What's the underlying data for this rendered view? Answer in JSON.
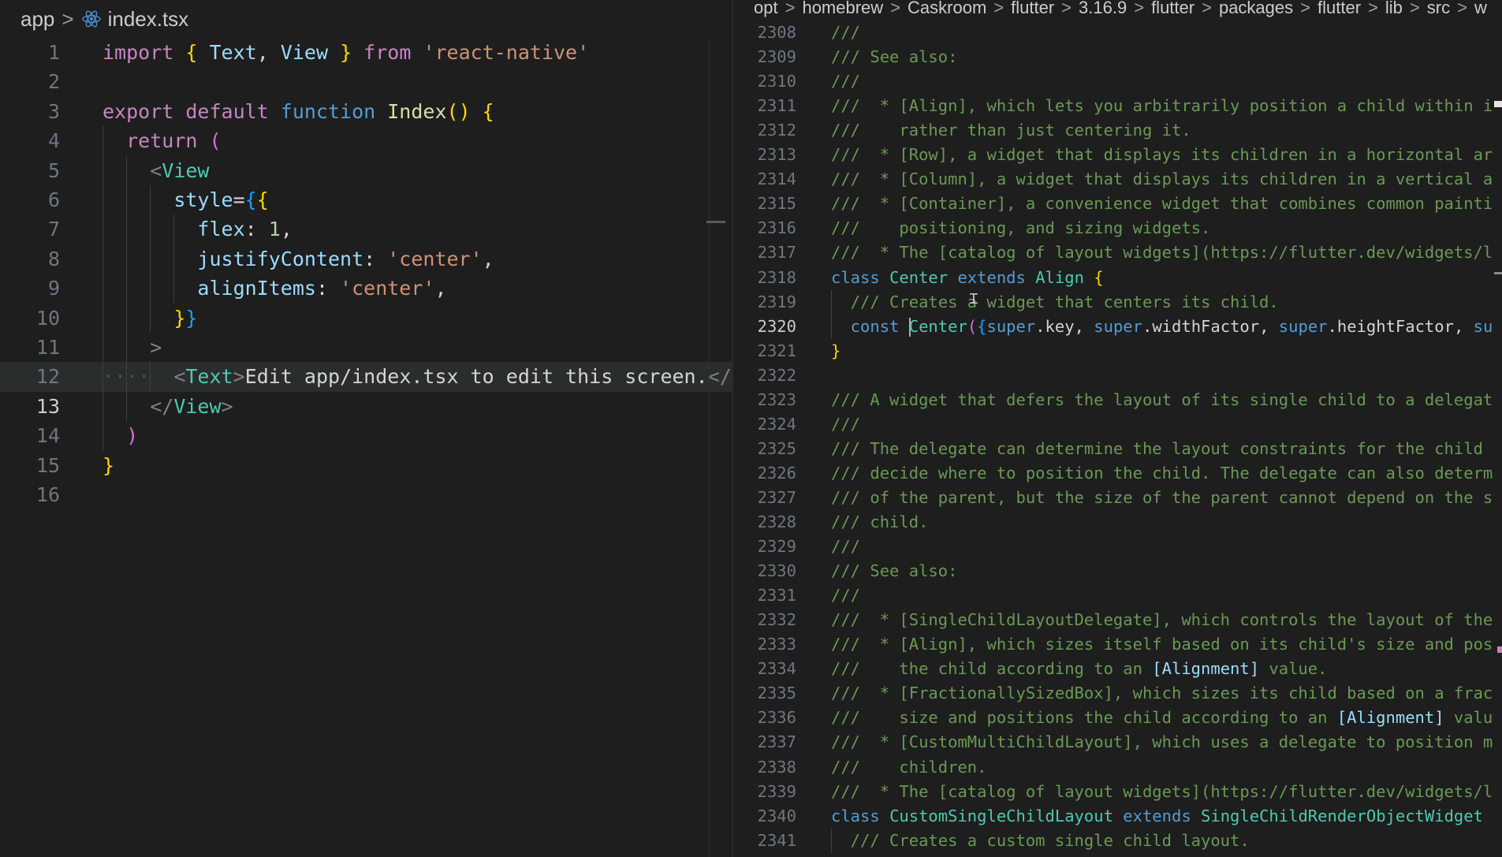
{
  "left_pane": {
    "breadcrumb": [
      "app",
      "index.tsx"
    ],
    "file_icon": "react-icon",
    "active_line": 13,
    "lines": [
      {
        "n": "1",
        "tokens": [
          {
            "t": "import ",
            "c": "kw"
          },
          {
            "t": "{ ",
            "c": "br1"
          },
          {
            "t": "Text",
            "c": "id"
          },
          {
            "t": ", ",
            "c": "tx"
          },
          {
            "t": "View",
            "c": "id"
          },
          {
            "t": " }",
            "c": "br1"
          },
          {
            "t": " from ",
            "c": "kw"
          },
          {
            "t": "'react-native'",
            "c": "str"
          }
        ]
      },
      {
        "n": "2",
        "tokens": []
      },
      {
        "n": "3",
        "tokens": [
          {
            "t": "export ",
            "c": "kw"
          },
          {
            "t": "default ",
            "c": "kw"
          },
          {
            "t": "function ",
            "c": "st"
          },
          {
            "t": "Index",
            "c": "fn"
          },
          {
            "t": "() ",
            "c": "br1"
          },
          {
            "t": "{",
            "c": "br1"
          }
        ]
      },
      {
        "n": "4",
        "tokens": [
          {
            "t": "  ",
            "c": "tx"
          },
          {
            "t": "return ",
            "c": "kw"
          },
          {
            "t": "(",
            "c": "br2"
          }
        ]
      },
      {
        "n": "5",
        "tokens": [
          {
            "t": "    ",
            "c": "tx"
          },
          {
            "t": "<",
            "c": "ang"
          },
          {
            "t": "View",
            "c": "tag"
          }
        ]
      },
      {
        "n": "6",
        "tokens": [
          {
            "t": "      ",
            "c": "tx"
          },
          {
            "t": "style",
            "c": "id"
          },
          {
            "t": "=",
            "c": "tx"
          },
          {
            "t": "{",
            "c": "br3"
          },
          {
            "t": "{",
            "c": "br1"
          }
        ]
      },
      {
        "n": "7",
        "tokens": [
          {
            "t": "        ",
            "c": "tx"
          },
          {
            "t": "flex",
            "c": "id"
          },
          {
            "t": ": ",
            "c": "tx"
          },
          {
            "t": "1",
            "c": "num"
          },
          {
            "t": ",",
            "c": "tx"
          }
        ]
      },
      {
        "n": "8",
        "tokens": [
          {
            "t": "        ",
            "c": "tx"
          },
          {
            "t": "justifyContent",
            "c": "id"
          },
          {
            "t": ": ",
            "c": "tx"
          },
          {
            "t": "'center'",
            "c": "str"
          },
          {
            "t": ",",
            "c": "tx"
          }
        ]
      },
      {
        "n": "9",
        "tokens": [
          {
            "t": "        ",
            "c": "tx"
          },
          {
            "t": "alignItems",
            "c": "id"
          },
          {
            "t": ": ",
            "c": "tx"
          },
          {
            "t": "'center'",
            "c": "str"
          },
          {
            "t": ",",
            "c": "tx"
          }
        ]
      },
      {
        "n": "10",
        "tokens": [
          {
            "t": "      ",
            "c": "tx"
          },
          {
            "t": "}",
            "c": "br1"
          },
          {
            "t": "}",
            "c": "br3"
          }
        ]
      },
      {
        "n": "11",
        "tokens": [
          {
            "t": "    ",
            "c": "tx"
          },
          {
            "t": ">",
            "c": "ang"
          }
        ]
      },
      {
        "n": "12",
        "tokens": [
          {
            "t": "····  ",
            "c": "whitespace"
          },
          {
            "t": "<",
            "c": "ang"
          },
          {
            "t": "Text",
            "c": "tag"
          },
          {
            "t": ">",
            "c": "ang"
          },
          {
            "t": "Edit app/index.tsx to edit this screen.",
            "c": "tx"
          },
          {
            "t": "</",
            "c": "ang"
          }
        ]
      },
      {
        "n": "13",
        "tokens": [
          {
            "t": "    ",
            "c": "tx"
          },
          {
            "t": "</",
            "c": "ang"
          },
          {
            "t": "View",
            "c": "tag"
          },
          {
            "t": ">",
            "c": "ang"
          }
        ]
      },
      {
        "n": "14",
        "tokens": [
          {
            "t": "  ",
            "c": "tx"
          },
          {
            "t": ")",
            "c": "br2"
          }
        ]
      },
      {
        "n": "15",
        "tokens": [
          {
            "t": "}",
            "c": "br1"
          }
        ]
      },
      {
        "n": "16",
        "tokens": []
      }
    ]
  },
  "right_pane": {
    "breadcrumb": [
      "opt",
      "homebrew",
      "Caskroom",
      "flutter",
      "3.16.9",
      "flutter",
      "packages",
      "flutter",
      "lib",
      "src",
      "w"
    ],
    "active_line": 2320,
    "lines": [
      {
        "n": "2308",
        "tokens": [
          {
            "t": "///",
            "c": "cm"
          }
        ]
      },
      {
        "n": "2309",
        "tokens": [
          {
            "t": "/// See also:",
            "c": "cm"
          }
        ]
      },
      {
        "n": "2310",
        "tokens": [
          {
            "t": "///",
            "c": "cm"
          }
        ]
      },
      {
        "n": "2311",
        "tokens": [
          {
            "t": "///  * [Align], which lets you arbitrarily position a child within i",
            "c": "cm"
          }
        ]
      },
      {
        "n": "2312",
        "tokens": [
          {
            "t": "///    rather than just centering it.",
            "c": "cm"
          }
        ]
      },
      {
        "n": "2313",
        "tokens": [
          {
            "t": "///  * [Row], a widget that displays its children in a horizontal ar",
            "c": "cm"
          }
        ]
      },
      {
        "n": "2314",
        "tokens": [
          {
            "t": "///  * [Column], a widget that displays its children in a vertical a",
            "c": "cm"
          }
        ]
      },
      {
        "n": "2315",
        "tokens": [
          {
            "t": "///  * [Container], a convenience widget that combines common painti",
            "c": "cm"
          }
        ]
      },
      {
        "n": "2316",
        "tokens": [
          {
            "t": "///    positioning, and sizing widgets.",
            "c": "cm"
          }
        ]
      },
      {
        "n": "2317",
        "tokens": [
          {
            "t": "///  * The [catalog of layout widgets](https://flutter.dev/widgets/l",
            "c": "cm"
          }
        ]
      },
      {
        "n": "2318",
        "tokens": [
          {
            "t": "class ",
            "c": "st"
          },
          {
            "t": "Center ",
            "c": "ty"
          },
          {
            "t": "extends ",
            "c": "st"
          },
          {
            "t": "Align ",
            "c": "ty"
          },
          {
            "t": "{",
            "c": "br1"
          }
        ]
      },
      {
        "n": "2319",
        "tokens": [
          {
            "t": "  /// Creates a widget that centers its child.",
            "c": "cm"
          }
        ]
      },
      {
        "n": "2320",
        "tokens": [
          {
            "t": "  const ",
            "c": "st"
          },
          {
            "t": "CURSOR",
            "c": "cursor"
          },
          {
            "t": "Center",
            "c": "ty"
          },
          {
            "t": "(",
            "c": "br2"
          },
          {
            "t": "{",
            "c": "br3"
          },
          {
            "t": "super",
            "c": "st"
          },
          {
            "t": ".key, ",
            "c": "tx"
          },
          {
            "t": "super",
            "c": "st"
          },
          {
            "t": ".widthFactor, ",
            "c": "tx"
          },
          {
            "t": "super",
            "c": "st"
          },
          {
            "t": ".heightFactor, ",
            "c": "tx"
          },
          {
            "t": "su",
            "c": "st"
          }
        ]
      },
      {
        "n": "2321",
        "tokens": [
          {
            "t": "}",
            "c": "br1"
          }
        ]
      },
      {
        "n": "2322",
        "tokens": []
      },
      {
        "n": "2323",
        "tokens": [
          {
            "t": "/// A widget that defers the layout of its single child to a delegat",
            "c": "cm"
          }
        ]
      },
      {
        "n": "2324",
        "tokens": [
          {
            "t": "///",
            "c": "cm"
          }
        ]
      },
      {
        "n": "2325",
        "tokens": [
          {
            "t": "/// The delegate can determine the layout constraints for the child ",
            "c": "cm"
          }
        ]
      },
      {
        "n": "2326",
        "tokens": [
          {
            "t": "/// decide where to position the child. The delegate can also determ",
            "c": "cm"
          }
        ]
      },
      {
        "n": "2327",
        "tokens": [
          {
            "t": "/// of the parent, but the size of the parent cannot depend on the s",
            "c": "cm"
          }
        ]
      },
      {
        "n": "2328",
        "tokens": [
          {
            "t": "/// child.",
            "c": "cm"
          }
        ]
      },
      {
        "n": "2329",
        "tokens": [
          {
            "t": "///",
            "c": "cm"
          }
        ]
      },
      {
        "n": "2330",
        "tokens": [
          {
            "t": "/// See also:",
            "c": "cm"
          }
        ]
      },
      {
        "n": "2331",
        "tokens": [
          {
            "t": "///",
            "c": "cm"
          }
        ]
      },
      {
        "n": "2332",
        "tokens": [
          {
            "t": "///  * [SingleChildLayoutDelegate], which controls the layout of the",
            "c": "cm"
          }
        ]
      },
      {
        "n": "2333",
        "tokens": [
          {
            "t": "///  * [Align], which sizes itself based on its child's size and pos",
            "c": "cm"
          }
        ]
      },
      {
        "n": "2334",
        "tokens": [
          {
            "t": "///    the child according to an ",
            "c": "cm"
          },
          {
            "t": "[Alignment]",
            "c": "ref"
          },
          {
            "t": " value.",
            "c": "cm"
          }
        ]
      },
      {
        "n": "2335",
        "tokens": [
          {
            "t": "///  * [FractionallySizedBox], which sizes its child based on a frac",
            "c": "cm"
          }
        ]
      },
      {
        "n": "2336",
        "tokens": [
          {
            "t": "///    size and positions the child according to an ",
            "c": "cm"
          },
          {
            "t": "[Alignment]",
            "c": "ref"
          },
          {
            "t": " valu",
            "c": "cm"
          }
        ]
      },
      {
        "n": "2337",
        "tokens": [
          {
            "t": "///  * [CustomMultiChildLayout], which uses a delegate to position m",
            "c": "cm"
          }
        ]
      },
      {
        "n": "2338",
        "tokens": [
          {
            "t": "///    children.",
            "c": "cm"
          }
        ]
      },
      {
        "n": "2339",
        "tokens": [
          {
            "t": "///  * The [catalog of layout widgets](https://flutter.dev/widgets/l",
            "c": "cm"
          }
        ]
      },
      {
        "n": "2340",
        "tokens": [
          {
            "t": "class ",
            "c": "st"
          },
          {
            "t": "CustomSingleChildLayout ",
            "c": "ty"
          },
          {
            "t": "extends ",
            "c": "st"
          },
          {
            "t": "SingleChildRenderObjectWidget",
            "c": "ty"
          }
        ]
      },
      {
        "n": "2341",
        "tokens": [
          {
            "t": "  /// Creates a custom single child layout.",
            "c": "cm"
          }
        ]
      }
    ]
  }
}
